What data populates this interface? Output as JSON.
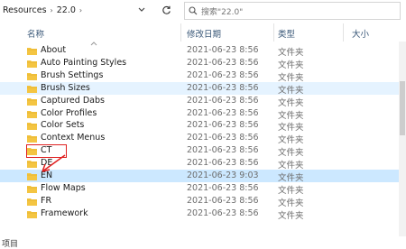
{
  "address": {
    "crumbs": [
      "Resources",
      "22.0"
    ],
    "separator": "›"
  },
  "search": {
    "placeholder": "搜索\"22.0\""
  },
  "columns": {
    "name": "名称",
    "date": "修改日期",
    "type": "类型",
    "size": "大小"
  },
  "rows": [
    {
      "name": "About",
      "date": "2021-06-23 8:56",
      "type": "文件夹",
      "state": ""
    },
    {
      "name": "Auto Painting Styles",
      "date": "2021-06-23 8:56",
      "type": "文件夹",
      "state": ""
    },
    {
      "name": "Brush Settings",
      "date": "2021-06-23 8:56",
      "type": "文件夹",
      "state": ""
    },
    {
      "name": "Brush Sizes",
      "date": "2021-06-23 8:56",
      "type": "文件夹",
      "state": "hover"
    },
    {
      "name": "Captured Dabs",
      "date": "2021-06-23 8:56",
      "type": "文件夹",
      "state": ""
    },
    {
      "name": "Color Profiles",
      "date": "2021-06-23 8:56",
      "type": "文件夹",
      "state": ""
    },
    {
      "name": "Color Sets",
      "date": "2021-06-23 8:56",
      "type": "文件夹",
      "state": ""
    },
    {
      "name": "Context Menus",
      "date": "2021-06-23 8:56",
      "type": "文件夹",
      "state": ""
    },
    {
      "name": "CT",
      "date": "2021-06-23 8:56",
      "type": "文件夹",
      "state": ""
    },
    {
      "name": "DE",
      "date": "2021-06-23 8:56",
      "type": "文件夹",
      "state": ""
    },
    {
      "name": "EN",
      "date": "2021-06-23 9:03",
      "type": "文件夹",
      "state": "selected"
    },
    {
      "name": "Flow Maps",
      "date": "2021-06-23 8:56",
      "type": "文件夹",
      "state": ""
    },
    {
      "name": "FR",
      "date": "2021-06-23 8:56",
      "type": "文件夹",
      "state": ""
    },
    {
      "name": "Framework",
      "date": "2021-06-23 8:56",
      "type": "文件夹",
      "state": ""
    }
  ],
  "status": {
    "text": "项目"
  },
  "colors": {
    "selection": "#cce8ff",
    "hover": "#e5f3ff",
    "folder": "#f4c542",
    "annotation": "#e02020"
  }
}
